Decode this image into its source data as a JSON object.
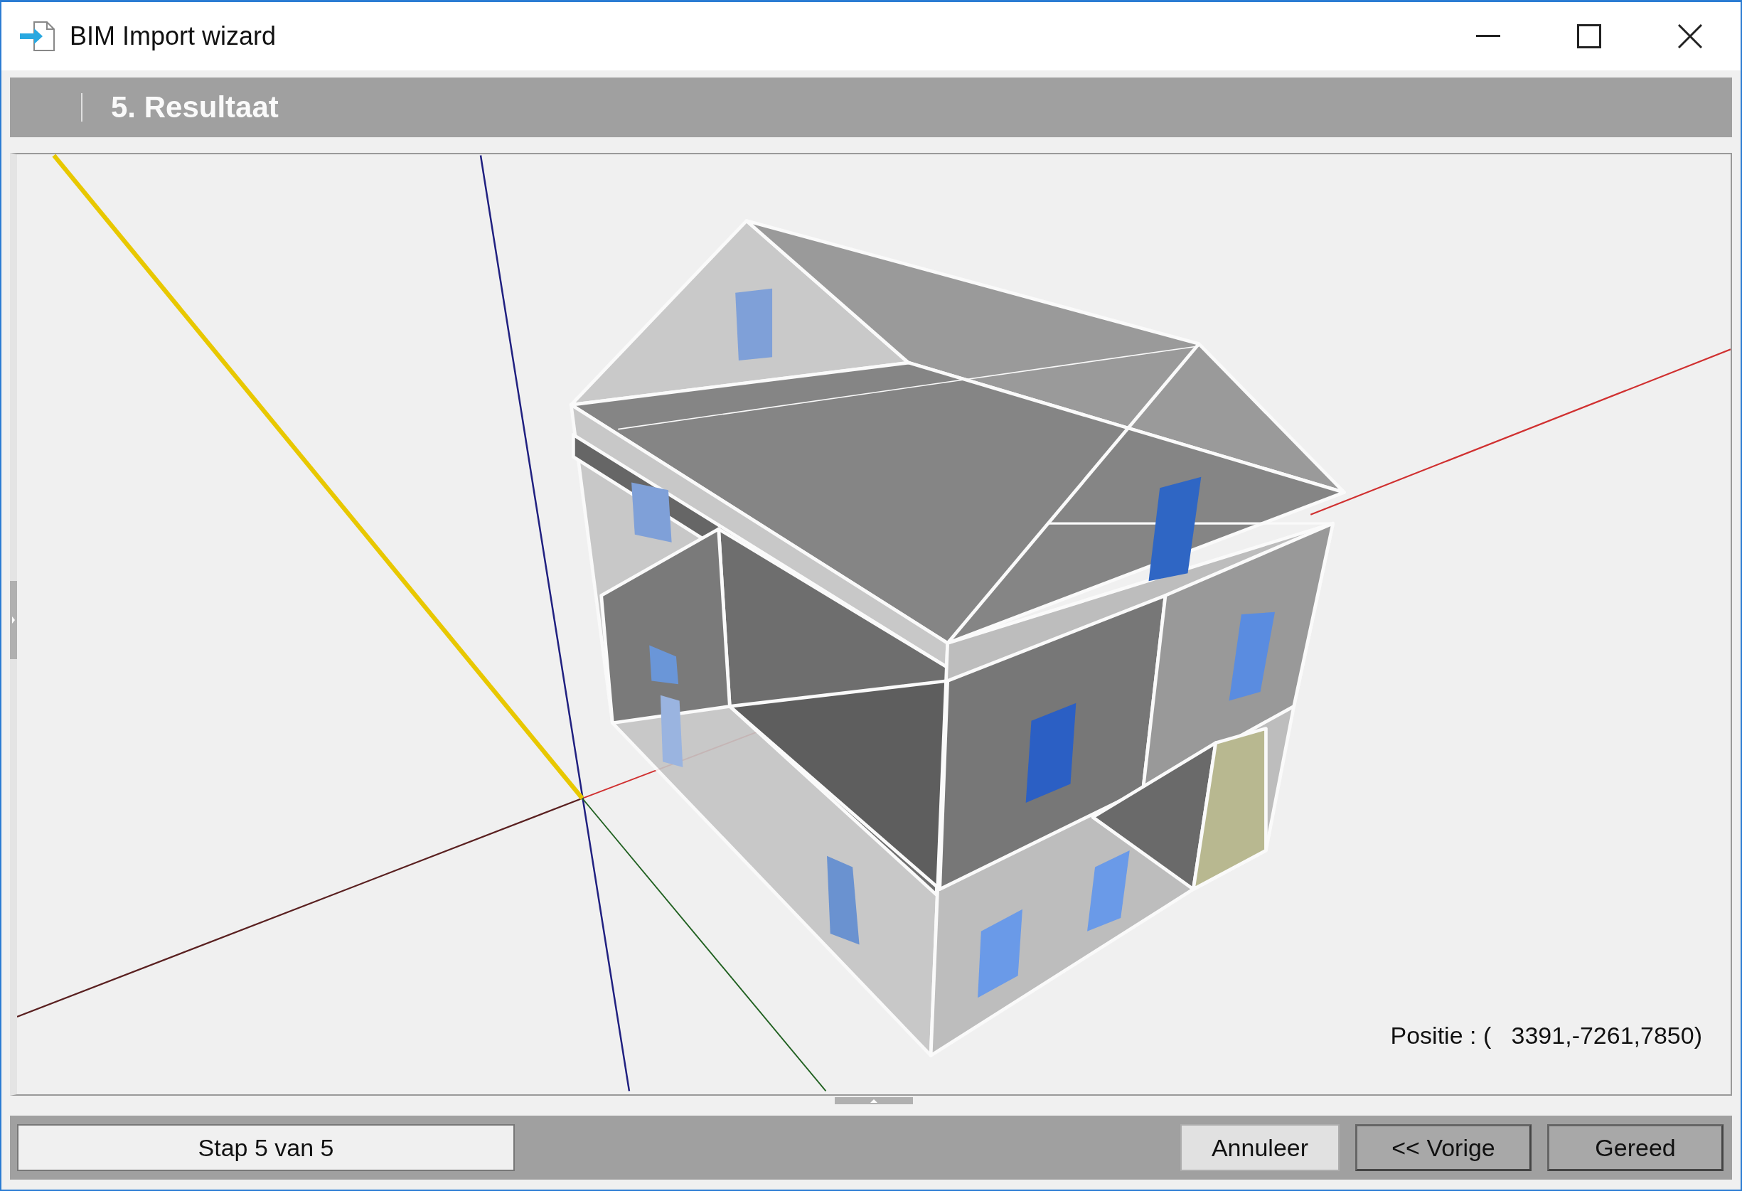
{
  "window": {
    "title": "BIM Import wizard"
  },
  "step_header": {
    "title": "5. Resultaat"
  },
  "viewport": {
    "position": "Positie : (   3391,-7261,7850)"
  },
  "footer": {
    "step_indicator": "Stap 5 van 5",
    "buttons": [
      {
        "label": "Annuleer",
        "kind": "plain"
      },
      {
        "label": "<< Vorige",
        "kind": "nav"
      },
      {
        "label": "Gereed",
        "kind": "nav"
      }
    ]
  }
}
